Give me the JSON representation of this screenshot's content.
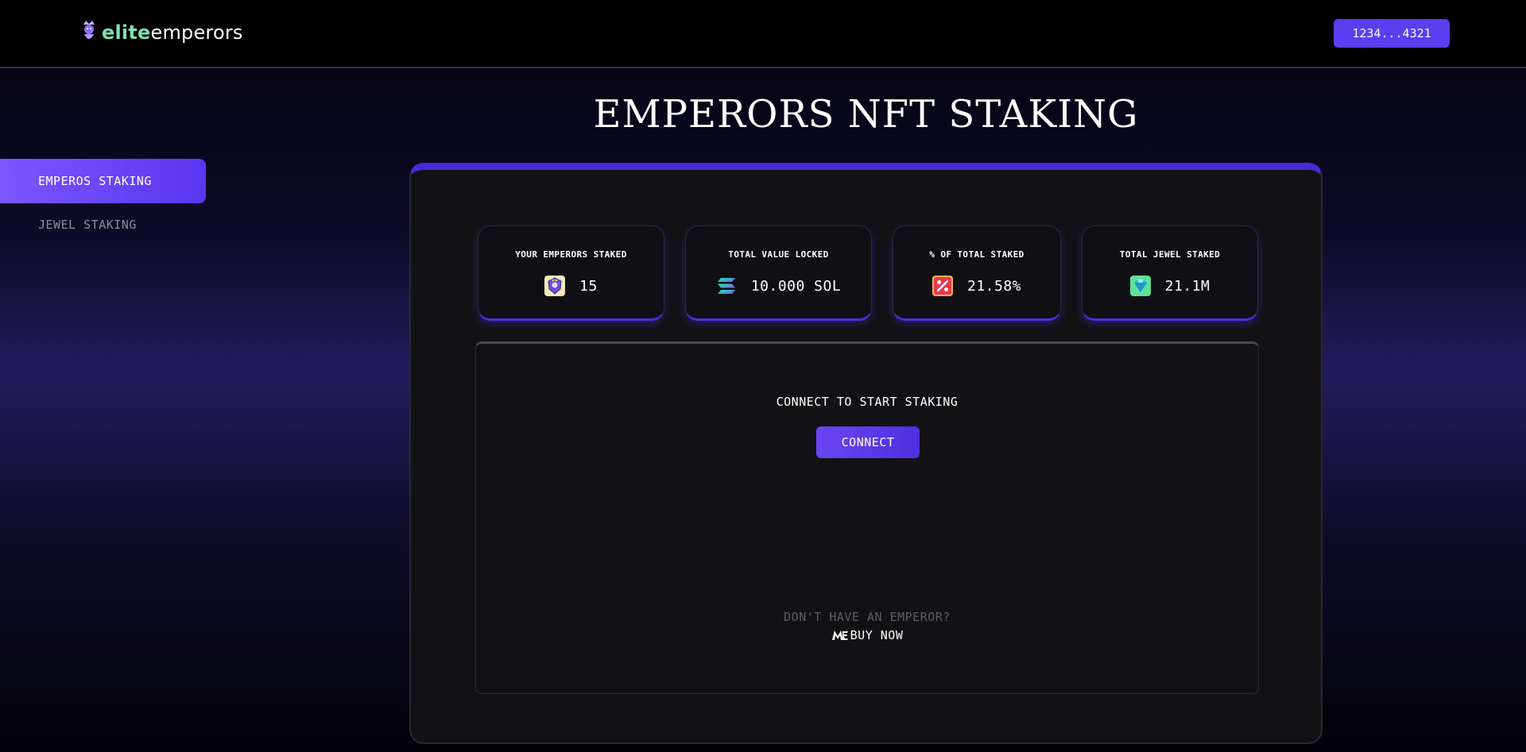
{
  "header": {
    "brand_elite": "elite",
    "brand_emperors": "emperors",
    "wallet_address": "1234...4321"
  },
  "sidebar": {
    "items": [
      {
        "label": "EMPEROS STAKING",
        "active": true
      },
      {
        "label": "JEWEL STAKING",
        "active": false
      }
    ]
  },
  "page": {
    "title": "EMPERORS NFT STAKING"
  },
  "stats": [
    {
      "label": "YOUR EMPERORS STAKED",
      "value": "15",
      "icon": "emperor-crest-icon"
    },
    {
      "label": "TOTAL VALUE LOCKED",
      "value": "10.000 SOL",
      "icon": "solana-icon"
    },
    {
      "label": "% OF TOTAL STAKED",
      "value": "21.58%",
      "icon": "percent-icon"
    },
    {
      "label": "TOTAL JEWEL STAKED",
      "value": "21.1M",
      "icon": "jewel-icon"
    }
  ],
  "connect": {
    "title": "CONNECT TO START STAKING",
    "button_label": "CONNECT",
    "no_emperor_text": "DON'T HAVE AN EMPEROR?",
    "buy_label": "BUY NOW",
    "buy_icon": "magic-eden-icon"
  },
  "colors": {
    "accent": "#5b3ef0",
    "brand_green": "#7fe0b0",
    "panel_top_border": "#4a29d6"
  }
}
